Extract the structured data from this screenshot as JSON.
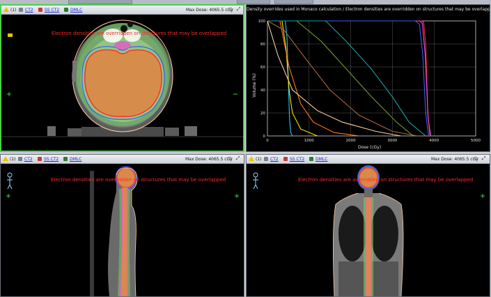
{
  "top_tabs": [
    {
      "label": ""
    },
    {
      "label": ""
    },
    {
      "label": ""
    }
  ],
  "panels": {
    "axial": {
      "toolbar": {
        "series1": "CT2",
        "series2": "SS CT2",
        "series3": "DMLC",
        "maxdose": "Max Dose: 4065.5 cGy"
      },
      "message": "Electron densities are overridden on structures that may be overlapped"
    },
    "dvh": {
      "title": "Density overrides used in Monaco calculation / Electron densities are overridden on structures that may be overlapped",
      "ylabel": "Volume (%)",
      "xlabel": "Dose (cGy)"
    },
    "sagittal": {
      "toolbar": {
        "series1": "CT2",
        "series2": "SS CT2",
        "series3": "DMLC",
        "maxdose": "Max Dose: 4065.5 cGy"
      },
      "message": "Electron densities are overridden on structures that may be overlapped"
    },
    "coronal": {
      "toolbar": {
        "series1": "CT2",
        "series2": "SS CT2",
        "series3": "DMLC",
        "maxdose": "Max Dose: 4065.5 cGy"
      },
      "message": "Electron densities are overridden on structures that may be overlapped"
    }
  },
  "chart_data": {
    "type": "line",
    "title": "Density overrides used in Monaco calculation / Electron densities are overridden on structures that may be overlapped",
    "xlabel": "Dose (cGy)",
    "ylabel": "Volume (%)",
    "xlim": [
      0,
      5000
    ],
    "ylim": [
      0,
      100
    ],
    "xticks": [
      0,
      1000,
      2000,
      3000,
      4000,
      5000
    ],
    "yticks": [
      0,
      20,
      40,
      60,
      80,
      100
    ],
    "grid": true,
    "series": [
      {
        "color": "#ff2a2a",
        "x": [
          0,
          3700,
          3750,
          3800,
          3850,
          3900
        ],
        "y": [
          100,
          100,
          99,
          80,
          20,
          0
        ]
      },
      {
        "color": "#ff4fd8",
        "x": [
          0,
          3650,
          3720,
          3790,
          3860,
          3920
        ],
        "y": [
          100,
          100,
          98,
          70,
          15,
          0
        ]
      },
      {
        "color": "#3a5cff",
        "x": [
          0,
          3550,
          3650,
          3730,
          3800,
          3870
        ],
        "y": [
          100,
          100,
          97,
          70,
          20,
          0
        ]
      },
      {
        "color": "#29c4ff",
        "x": [
          0,
          430,
          470,
          500,
          530,
          560,
          600
        ],
        "y": [
          100,
          100,
          85,
          50,
          15,
          3,
          0
        ]
      },
      {
        "color": "#ffe600",
        "x": [
          0,
          350,
          450,
          520,
          600,
          800,
          1200
        ],
        "y": [
          100,
          100,
          75,
          40,
          20,
          6,
          0
        ]
      },
      {
        "color": "#ff7a1a",
        "x": [
          0,
          300,
          520,
          800,
          1100,
          1600,
          2200
        ],
        "y": [
          100,
          100,
          60,
          28,
          12,
          3,
          0
        ]
      },
      {
        "color": "#ffd0a0",
        "x": [
          0,
          250,
          600,
          1200,
          1800,
          2600,
          3200
        ],
        "y": [
          100,
          70,
          40,
          22,
          12,
          4,
          0
        ]
      },
      {
        "color": "#b06a3a",
        "x": [
          0,
          400,
          900,
          1500,
          2200,
          3000,
          3600
        ],
        "y": [
          100,
          92,
          68,
          40,
          18,
          4,
          0
        ]
      },
      {
        "color": "#6e9d2a",
        "x": [
          0,
          700,
          1300,
          1900,
          2500,
          3100,
          3500
        ],
        "y": [
          100,
          100,
          82,
          58,
          34,
          12,
          0
        ]
      },
      {
        "color": "#16a3a6",
        "x": [
          0,
          1400,
          1900,
          2500,
          3000,
          3400,
          3800
        ],
        "y": [
          100,
          100,
          82,
          58,
          34,
          12,
          0
        ]
      }
    ]
  }
}
